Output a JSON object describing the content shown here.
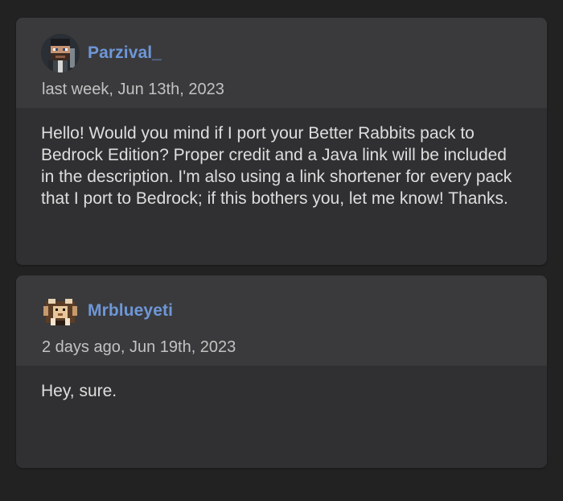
{
  "comments": [
    {
      "username": "Parzival_",
      "timestamp": "last week, Jun 13th, 2023",
      "body": "Hello! Would you mind if I port your Better Rabbits pack to Bedrock Edition? Proper credit and a Java link will be included in the description. I'm also using a link shortener for every pack that I port to Bedrock; if this bothers you, let me know! Thanks.",
      "avatar_icon": "pixel-character-avatar"
    },
    {
      "username": "Mrblueyeti",
      "timestamp": "2 days ago, Jun 19th, 2023",
      "body": "Hey, sure.",
      "avatar_icon": "pixel-yeti-avatar"
    }
  ],
  "colors": {
    "background": "#222223",
    "card": "#303032",
    "card_header": "#3a3a3c",
    "username": "#6e97d8",
    "text": "#dedede",
    "muted_text": "#c2c2c2"
  }
}
